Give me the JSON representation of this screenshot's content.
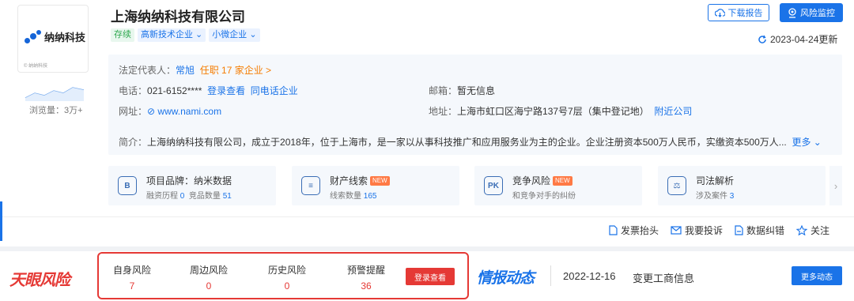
{
  "logo": {
    "brand_text": "纳纳科技",
    "small_text": "© 纳纳科技"
  },
  "views": {
    "label": "浏览量：3万+"
  },
  "header": {
    "title": "上海纳纳科技有限公司",
    "tags": [
      "存续",
      "高新技术企业 ⌄",
      "小微企业 ⌄"
    ],
    "report_label": "下载报告",
    "monitor_label": "风险监控",
    "updated": "2023-04-24更新"
  },
  "info": {
    "legal_rep_label": "法定代表人：",
    "legal_rep_name": "常旭",
    "legal_rep_jobs": "任职 17 家企业 >",
    "phone_label": "电话：",
    "phone_value": "021-6152****",
    "phone_login": "登录查看",
    "phone_same": "同电话企业",
    "email_label": "邮箱：",
    "email_value": "暂无信息",
    "site_label": "网址：",
    "site_value": "www.nami.com",
    "address_label": "地址：",
    "address_value": "上海市虹口区海宁路137号7层（集中登记地）",
    "address_nearby": "附近公司",
    "intro_label": "简介：",
    "intro_value": "上海纳纳科技有限公司，成立于2018年，位于上海市，是一家以从事科技推广和应用服务业为主的企业。企业注册资本500万人民币，实缴资本500万人...",
    "intro_more": "更多 ⌄"
  },
  "cards": [
    {
      "icon": "B",
      "title": "项目品牌：纳米数据",
      "sub1": "融资历程",
      "num1": "0",
      "sub2": "竞品数量",
      "num2": "51",
      "new": ""
    },
    {
      "icon": "≡",
      "title": "财产线索",
      "sub1": "线索数量",
      "num1": "165",
      "sub2": "",
      "num2": "",
      "new": "NEW"
    },
    {
      "icon": "PK",
      "title": "竞争风险",
      "sub1": "和竞争对手的纠纷",
      "num1": "",
      "sub2": "",
      "num2": "",
      "new": "NEW"
    },
    {
      "icon": "⚖",
      "title": "司法解析",
      "sub1": "涉及案件",
      "num1": "3",
      "sub2": "",
      "num2": "",
      "new": ""
    }
  ],
  "actions": [
    "发票抬头",
    "我要投诉",
    "数据纠错",
    "关注"
  ],
  "bottom": {
    "tianyan": "天眼风险",
    "risks": [
      {
        "label": "自身风险",
        "value": "7"
      },
      {
        "label": "周边风险",
        "value": "0"
      },
      {
        "label": "历史风险",
        "value": "0"
      },
      {
        "label": "预警提醒",
        "value": "36"
      }
    ],
    "login_btn": "登录查看",
    "qbdt": "情报动态",
    "news_date": "2022-12-16",
    "news_text": "变更工商信息",
    "more_btn": "更多动态"
  }
}
